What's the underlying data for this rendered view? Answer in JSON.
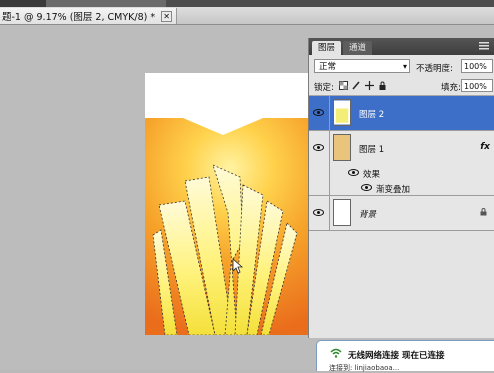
{
  "document": {
    "tab_title": "题-1 @ 9.17% (图层 2, CMYK/8) *",
    "close_symbol": "✕"
  },
  "layers_panel": {
    "tabs": [
      "图层",
      "通道"
    ],
    "blend_mode": "正常",
    "opacity_label": "不透明度:",
    "opacity_value": "100%",
    "lock_label": "锁定:",
    "fill_label": "填充:",
    "fill_value": "100%",
    "layers": [
      {
        "name": "图层 2",
        "selected": true
      },
      {
        "name": "图层 1",
        "selected": false,
        "fx": "fx"
      },
      {
        "name": "背景",
        "selected": false
      }
    ],
    "effects_label": "效果",
    "effect_item": "渐变叠加"
  },
  "toast": {
    "title": "无线网络连接 现在已连接",
    "subtitle": "连接到: linjiaobaoa..."
  },
  "icons": {
    "eye": "eye-icon",
    "lock": "lock-icon",
    "panel_menu": "panel-menu-icon",
    "wifi": "wifi-icon"
  },
  "colors": {
    "selection": "#3d6fc9",
    "panel_bg": "#e4e4e4",
    "workspace_bg": "#bcbcbc",
    "orange": "#ee7a1e",
    "yellow": "#fff07a"
  }
}
